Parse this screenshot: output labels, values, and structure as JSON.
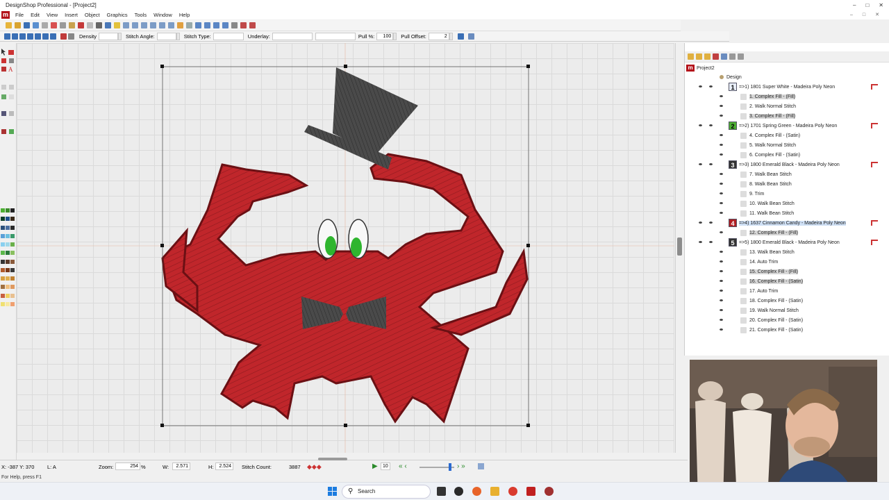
{
  "window": {
    "title": "DesignShop Professional - [Project2]",
    "logo": "m"
  },
  "menu": [
    "File",
    "Edit",
    "View",
    "Insert",
    "Object",
    "Graphics",
    "Tools",
    "Window",
    "Help"
  ],
  "toolbar": {
    "density_label": "Density",
    "stitch_angle_label": "Stitch Angle:",
    "stitch_type_label": "Stitch Type:",
    "underlay_label": "Underlay:",
    "pull_pct_label": "Pull %:",
    "pull_pct_value": "100",
    "pull_offset_label": "Pull Offset:",
    "pull_offset_value": "2"
  },
  "panel": {
    "project": "Project2",
    "design": "Design",
    "rows": [
      {
        "kind": "color",
        "num": "1",
        "color": "#e8eef8",
        "numcolor": "#000",
        "label": "=>1) 1801 Super White - Madeira Poly Neon",
        "hl": false
      },
      {
        "kind": "obj",
        "label": "1. Complex Fill - (Fill)",
        "sel": true
      },
      {
        "kind": "obj",
        "label": "2. Walk Normal Stitch",
        "sel": false
      },
      {
        "kind": "obj",
        "label": "3. Complex Fill - (Fill)",
        "sel": true
      },
      {
        "kind": "color",
        "num": "2",
        "color": "#4caf32",
        "numcolor": "#000",
        "label": "=>2) 1701 Spring Green - Madeira Poly Neon",
        "hl": false
      },
      {
        "kind": "obj",
        "label": "4. Complex Fill - (Satin)",
        "sel": false
      },
      {
        "kind": "obj",
        "label": "5. Walk Normal Stitch",
        "sel": false
      },
      {
        "kind": "obj",
        "label": "6. Complex Fill - (Satin)",
        "sel": false
      },
      {
        "kind": "color",
        "num": "3",
        "color": "#333333",
        "numcolor": "#fff",
        "label": "=>3) 1800 Emerald Black - Madeira Poly Neon",
        "hl": false
      },
      {
        "kind": "obj",
        "label": "7. Walk Bean Stitch",
        "sel": false
      },
      {
        "kind": "obj",
        "label": "8. Walk Bean Stitch",
        "sel": false
      },
      {
        "kind": "obj",
        "label": "9. Trim",
        "sel": false
      },
      {
        "kind": "obj",
        "label": "10. Walk Bean Stitch",
        "sel": false
      },
      {
        "kind": "obj",
        "label": "11. Walk Bean Stitch",
        "sel": false
      },
      {
        "kind": "color",
        "num": "4",
        "color": "#b01e22",
        "numcolor": "#fff",
        "label": "=>4) 1637 Cinnamon Candy - Madeira Poly Neon",
        "hl": true
      },
      {
        "kind": "obj",
        "label": "12. Complex Fill - (Fill)",
        "sel": true
      },
      {
        "kind": "color",
        "num": "5",
        "color": "#333333",
        "numcolor": "#fff",
        "label": "=>5) 1800 Emerald Black - Madeira Poly Neon",
        "hl": false
      },
      {
        "kind": "obj",
        "label": "13. Walk Bean Stitch",
        "sel": false
      },
      {
        "kind": "obj",
        "label": "14. Auto Trim",
        "sel": false
      },
      {
        "kind": "obj",
        "label": "15. Complex Fill - (Fill)",
        "sel": true
      },
      {
        "kind": "obj",
        "label": "16. Complex Fill - (Satin)",
        "sel": true
      },
      {
        "kind": "obj",
        "label": "17. Auto Trim",
        "sel": false
      },
      {
        "kind": "obj",
        "label": "18. Complex Fill - (Satin)",
        "sel": false
      },
      {
        "kind": "obj",
        "label": "19. Walk Normal Stitch",
        "sel": false
      },
      {
        "kind": "obj",
        "label": "20. Complex Fill - (Satin)",
        "sel": false
      },
      {
        "kind": "obj",
        "label": "21. Complex Fill - (Satin)",
        "sel": false
      }
    ]
  },
  "status": {
    "coords": "X: -387  Y: 370",
    "layer": "L: A",
    "zoom_label": "Zoom:",
    "zoom_value": "254",
    "zoom_unit": "%",
    "w_label": "W:",
    "w_value": "2.571",
    "h_label": "H:",
    "h_value": "2.524",
    "stitch_count_label": "Stitch Count:",
    "stitch_count_value": "3887",
    "speed_value": "10"
  },
  "help": "For Help, press F1",
  "taskbar": {
    "search": "Search"
  },
  "colors": {
    "crab": "#c0262b",
    "hat": "#4a4a4a",
    "eye_green": "#2fb52f",
    "accent": "#b3121a"
  }
}
